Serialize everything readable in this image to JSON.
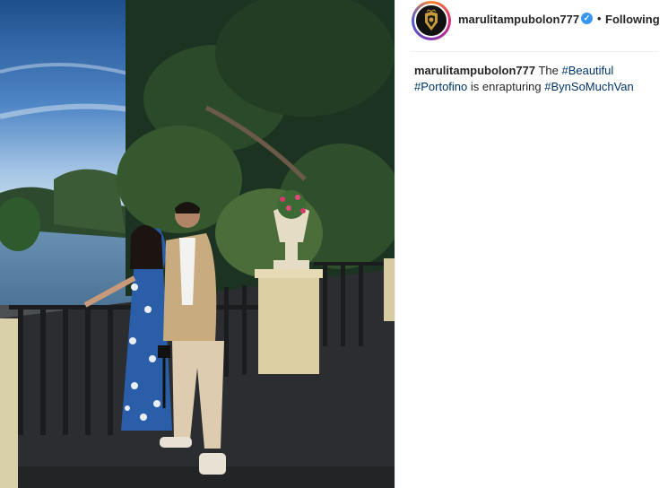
{
  "post": {
    "username": "marulitampubolon777",
    "verified_icon": "verified-badge-icon",
    "follow_status": "Following",
    "separator": "•"
  },
  "caption": {
    "username": "marulitampubolon777",
    "text_before": " The ",
    "hashtag1": "#Beautiful",
    "hashtag2": "#Portofino",
    "text_middle": " is enrapturing ",
    "hashtag3": "#BynSoMuchVan"
  },
  "colors": {
    "accent": "#3897f0",
    "hashtag": "#003569",
    "text": "#262626"
  }
}
